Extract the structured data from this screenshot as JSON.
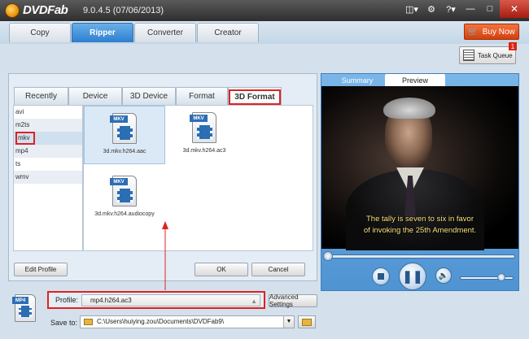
{
  "window": {
    "brand": "DVDFab",
    "version": "9.0.4.5 (07/06/2013)"
  },
  "title_icons": [
    "window-mode-icon",
    "gear-icon",
    "help-icon",
    "minimize-icon",
    "maximize-icon",
    "close-icon"
  ],
  "main_tabs": [
    {
      "label": "Copy"
    },
    {
      "label": "Ripper"
    },
    {
      "label": "Converter"
    },
    {
      "label": "Creator"
    }
  ],
  "buy_now": {
    "label": "Buy Now"
  },
  "task_queue": {
    "label": "Task Queue",
    "badge": "1"
  },
  "sub_tabs": [
    {
      "label": "Recently"
    },
    {
      "label": "Device"
    },
    {
      "label": "3D Device"
    },
    {
      "label": "Format"
    },
    {
      "label": "3D Format"
    }
  ],
  "formats": [
    "avi",
    "m2ts",
    "mkv",
    "mp4",
    "ts",
    "wmv"
  ],
  "profiles": [
    {
      "tag": "MKV",
      "label": "3d.mkv.h264.aac"
    },
    {
      "tag": "MKV",
      "label": "3d.mkv.h264.ac3"
    },
    {
      "tag": "MKV",
      "label": "3d.mkv.h264.audiocopy"
    }
  ],
  "buttons": {
    "edit_profile": "Edit Profile",
    "ok": "OK",
    "cancel": "Cancel",
    "advanced": "Advanced Settings"
  },
  "preview_tabs": [
    {
      "label": "Summary"
    },
    {
      "label": "Preview"
    }
  ],
  "video": {
    "subtitle_line1": "The tally is seven to six in favor",
    "subtitle_line2": "of invoking the 25th Amendment."
  },
  "profile": {
    "label": "Profile:",
    "value": "mp4.h264.ac3",
    "icon_tag": "MP4"
  },
  "save_to": {
    "label": "Save to:",
    "path": "C:\\Users\\huiying.zou\\Documents\\DVDFab9\\"
  },
  "colors": {
    "accent_blue": "#2d7fcf",
    "highlight_red": "#dd2222",
    "buy_orange": "#e2531f"
  }
}
